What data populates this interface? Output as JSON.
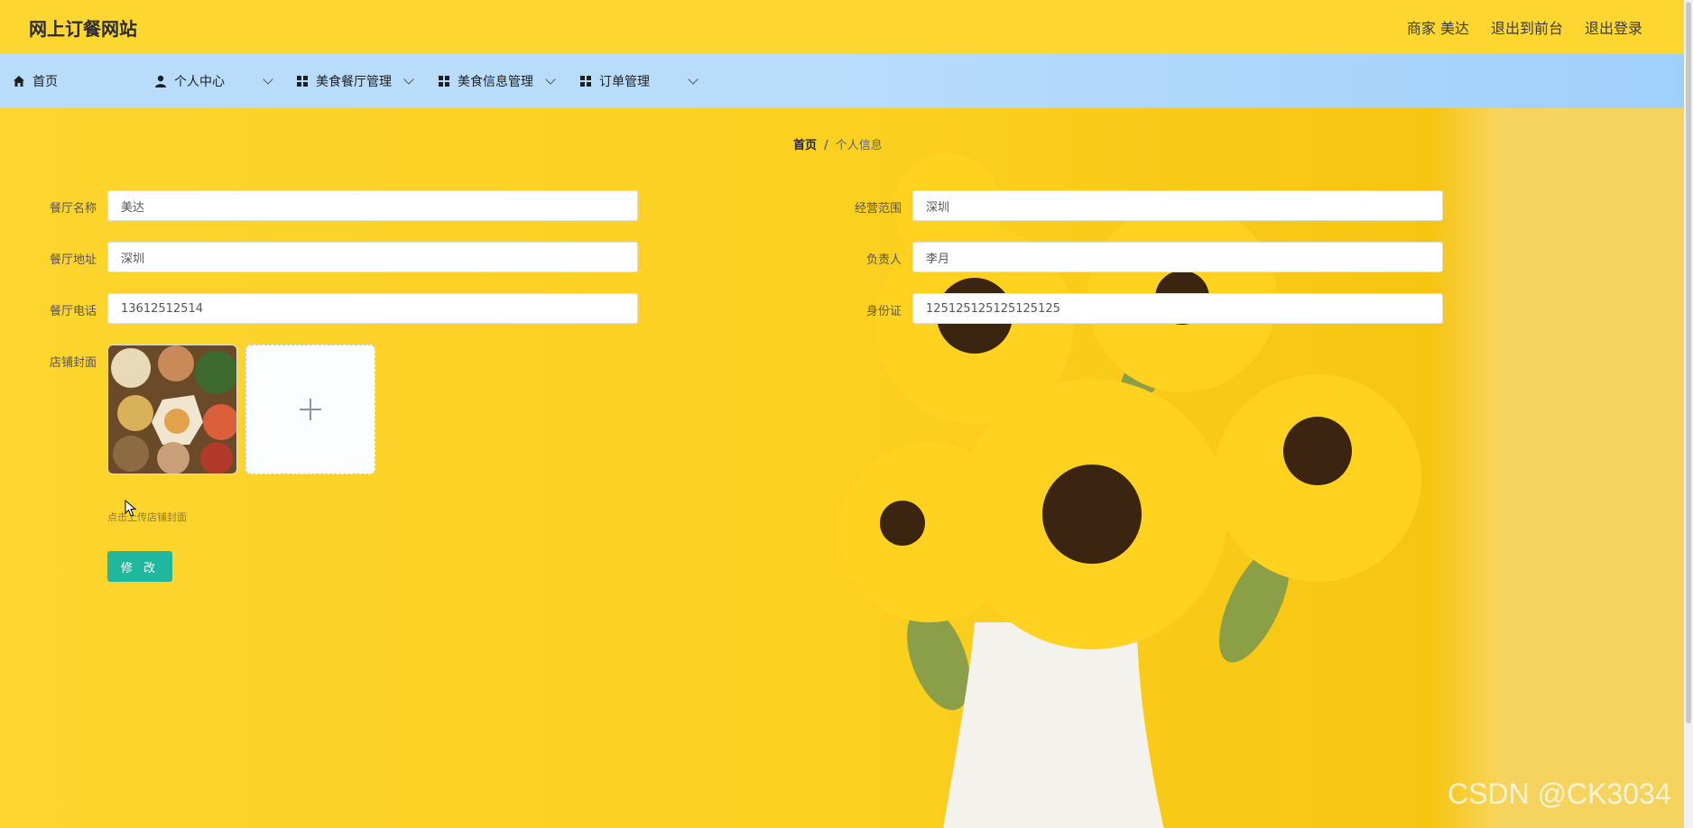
{
  "header": {
    "site_title": "网上订餐网站",
    "user_label": "商家 美达",
    "front_link": "退出到前台",
    "logout_link": "退出登录"
  },
  "nav": {
    "items": [
      {
        "label": "首页",
        "icon": "home-icon",
        "has_dropdown": false
      },
      {
        "label": "个人中心",
        "icon": "user-icon",
        "has_dropdown": true
      },
      {
        "label": "美食餐厅管理",
        "icon": "grid-icon",
        "has_dropdown": true
      },
      {
        "label": "美食信息管理",
        "icon": "grid-icon",
        "has_dropdown": true
      },
      {
        "label": "订单管理",
        "icon": "grid-icon",
        "has_dropdown": true
      }
    ]
  },
  "breadcrumb": {
    "home": "首页",
    "separator": "/",
    "current": "个人信息"
  },
  "form": {
    "restaurant_name": {
      "label": "餐厅名称",
      "value": "美达"
    },
    "business_scope": {
      "label": "经营范围",
      "value": "深圳"
    },
    "restaurant_address": {
      "label": "餐厅地址",
      "value": "深圳"
    },
    "manager": {
      "label": "负责人",
      "value": "李月"
    },
    "restaurant_phone": {
      "label": "餐厅电话",
      "value": "13612512514"
    },
    "id_card": {
      "label": "身份证",
      "value": "125125125125125125"
    },
    "cover": {
      "label": "店铺封面",
      "tip": "点击上传店铺封面"
    },
    "submit_label": "修 改"
  },
  "watermark": "CSDN @CK3034",
  "colors": {
    "header_bg": "#fdd72f",
    "nav_bg": "#b9dcfb",
    "content_bg": "#fcd52e",
    "button_bg": "#1fb79e"
  }
}
